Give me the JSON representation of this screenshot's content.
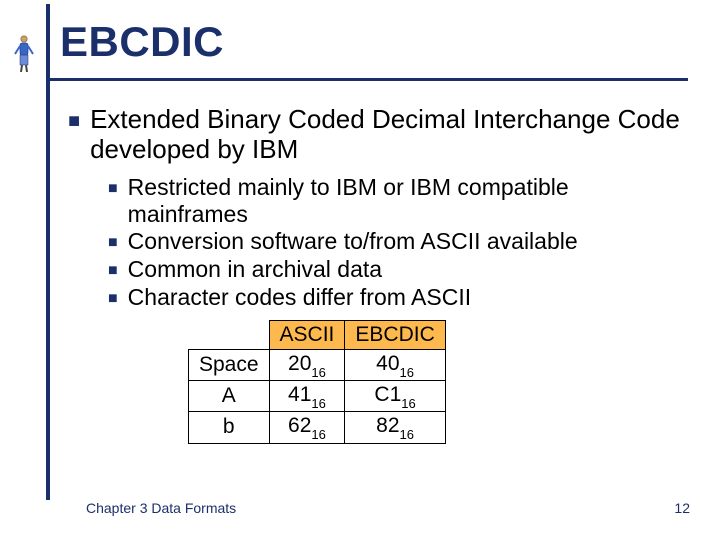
{
  "title": "EBCDIC",
  "bullets": [
    {
      "text": "Extended Binary Coded Decimal Interchange Code developed by IBM",
      "children": [
        "Restricted mainly to IBM or IBM compatible mainframes",
        "Conversion software to/from ASCII available",
        "Common in archival data",
        "Character codes differ from ASCII"
      ]
    }
  ],
  "table": {
    "columns": [
      "ASCII",
      "EBCDIC"
    ],
    "base": "16",
    "rows": [
      {
        "label": "Space",
        "ascii": "20",
        "ebcdic": "40"
      },
      {
        "label": "A",
        "ascii": "41",
        "ebcdic": "C1"
      },
      {
        "label": "b",
        "ascii": "62",
        "ebcdic": "82"
      }
    ]
  },
  "footer": {
    "chapter": "Chapter 3 Data Formats",
    "page": "12"
  },
  "colors": {
    "accent": "#1b2f6b",
    "table_header_bg": "#fdb94e"
  }
}
